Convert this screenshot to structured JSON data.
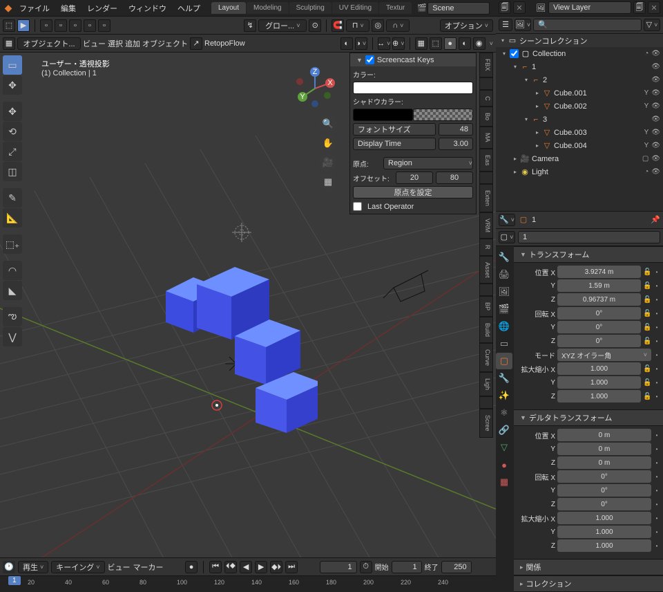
{
  "top": {
    "menus": [
      "ファイル",
      "編集",
      "レンダー",
      "ウィンドウ",
      "ヘルプ"
    ],
    "tabs": [
      "Layout",
      "Modeling",
      "Sculpting",
      "UV Editing",
      "Textur"
    ],
    "active_tab": 0,
    "scene_label": "Scene",
    "viewlayer_label": "View Layer"
  },
  "vph": {
    "mode": "オブジェクト...",
    "glow": "グロー...",
    "options": "オプション",
    "menus": [
      "ビュー",
      "選択",
      "追加",
      "オブジェクト"
    ],
    "retopo": "RetopoFlow"
  },
  "view": {
    "title": "ユーザー・透視投影",
    "subtitle": "(1) Collection | 1"
  },
  "screencast": {
    "title": "Screencast Keys",
    "enabled": true,
    "color": "カラー:",
    "color_v": "#ffffff",
    "shadow": "シャドウカラー:",
    "shadow_v": "#000000",
    "fontsz": "フォントサイズ",
    "fontsz_v": "48",
    "disptime": "Display Time",
    "disptime_v": "3.00",
    "origin": "原点:",
    "origin_v": "Region",
    "offset": "オフセット:",
    "offx": "20",
    "offy": "80",
    "setorigin": "原点を設定",
    "lastop": "Last Operator"
  },
  "ntabs": [
    "FBX",
    "",
    "C",
    "Bo",
    "MA",
    "Eas",
    "",
    "Exten",
    "VRM",
    "R",
    "Asset",
    "",
    "BP",
    "Build",
    "Curve",
    "Ligh",
    "",
    "Scree"
  ],
  "timeline": {
    "play": "再生",
    "keying": "キーイング",
    "view": "ビュー",
    "marker": "マーカー",
    "frame": "1",
    "start_l": "開始",
    "start": "1",
    "end_l": "終了",
    "end": "250",
    "ticks": [
      "20",
      "40",
      "60",
      "80",
      "100",
      "120",
      "140",
      "160",
      "180",
      "200",
      "220",
      "240"
    ]
  },
  "outliner": {
    "title": "シーンコレクション",
    "tree": [
      {
        "indent": 0,
        "tw": "▾",
        "chk": true,
        "ic": "▢",
        "c": "#fff",
        "name": "Collection",
        "r": [
          "◔",
          "👁"
        ]
      },
      {
        "indent": 1,
        "tw": "▾",
        "ic": "⌐",
        "c": "#e57a33",
        "name": "1",
        "r": [
          "👁"
        ]
      },
      {
        "indent": 2,
        "tw": "▾",
        "ic": "⌐",
        "c": "#e57a33",
        "name": "2",
        "r": [
          "👁"
        ]
      },
      {
        "indent": 3,
        "tw": "▸",
        "ic": "▽",
        "c": "#e57a33",
        "name": "Cube.001",
        "r": [
          "Y",
          "👁"
        ]
      },
      {
        "indent": 3,
        "tw": "▸",
        "ic": "▽",
        "c": "#e57a33",
        "name": "Cube.002",
        "r": [
          "Y",
          "👁"
        ]
      },
      {
        "indent": 2,
        "tw": "▾",
        "ic": "⌐",
        "c": "#e57a33",
        "name": "3",
        "r": [
          "👁"
        ]
      },
      {
        "indent": 3,
        "tw": "▸",
        "ic": "▽",
        "c": "#e57a33",
        "name": "Cube.003",
        "r": [
          "Y",
          "👁"
        ]
      },
      {
        "indent": 3,
        "tw": "▸",
        "ic": "▽",
        "c": "#e57a33",
        "name": "Cube.004",
        "r": [
          "Y",
          "👁"
        ]
      },
      {
        "indent": 1,
        "tw": "▸",
        "ic": "🎥",
        "c": "#8fd14f",
        "name": "Camera",
        "r": [
          "▢",
          "👁"
        ]
      },
      {
        "indent": 1,
        "tw": "▸",
        "ic": "◉",
        "c": "#e0c84f",
        "name": "Light",
        "r": [
          "◔",
          "👁"
        ]
      }
    ]
  },
  "props": {
    "crumb": "1",
    "crumb2": "1",
    "transform": "トランスフォーム",
    "loc": "位置",
    "rot": "回転",
    "scale": "拡大縮小",
    "mode": "モード",
    "modev": "XYZ オイラー角",
    "x": "X",
    "y": "Y",
    "z": "Z",
    "loc_v": [
      "3.9274 m",
      "1.59 m",
      "0.96737 m"
    ],
    "rot_v": [
      "0°",
      "0°",
      "0°"
    ],
    "scale_v": [
      "1.000",
      "1.000",
      "1.000"
    ],
    "delta": "デルタトランスフォーム",
    "dloc_v": [
      "0 m",
      "0 m",
      "0 m"
    ],
    "drot_v": [
      "0°",
      "0°",
      "0°"
    ],
    "dscale_v": [
      "1.000",
      "1.000",
      "1.000"
    ],
    "relations": "関係",
    "collection": "コレクション"
  }
}
